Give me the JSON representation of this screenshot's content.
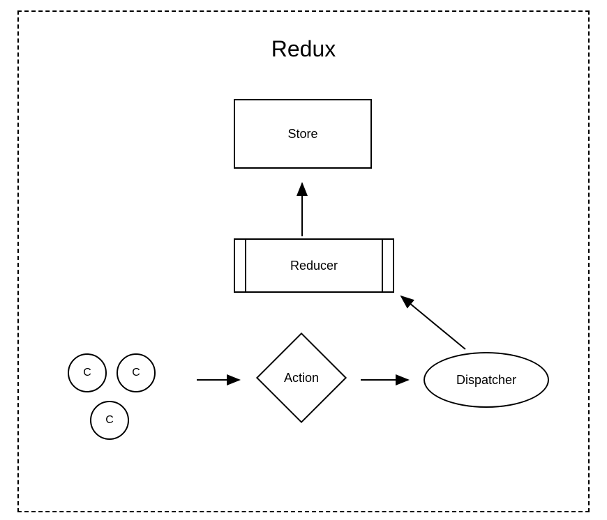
{
  "diagram": {
    "title": "Redux",
    "store": "Store",
    "reducer": "Reducer",
    "action": "Action",
    "dispatcher": "Dispatcher",
    "components": {
      "c1": "C",
      "c2": "C",
      "c3": "C"
    }
  }
}
